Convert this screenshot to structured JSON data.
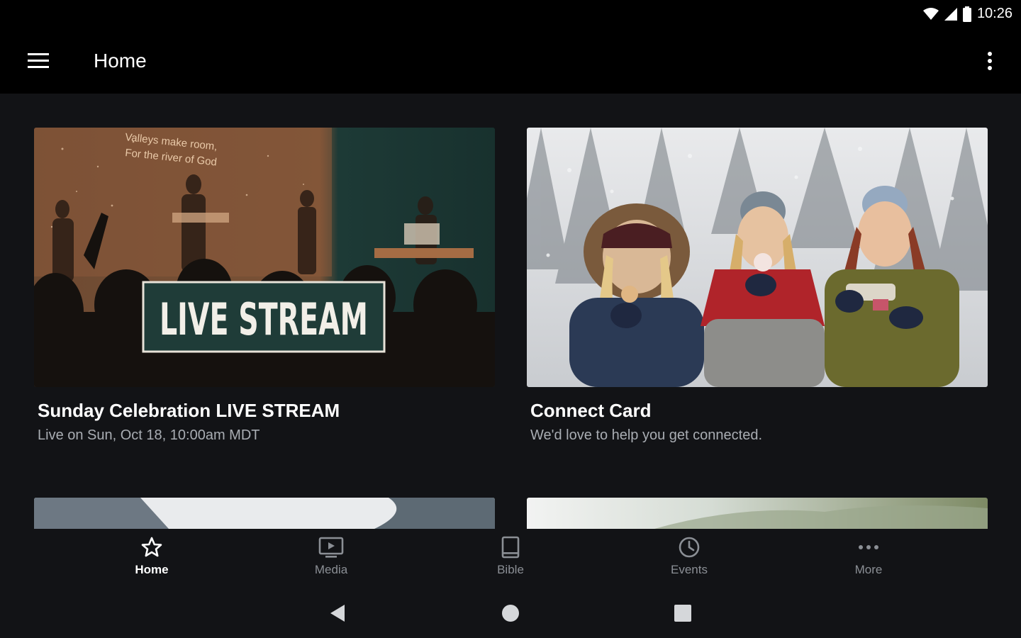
{
  "status": {
    "time": "10:26"
  },
  "appbar": {
    "title": "Home"
  },
  "cards": [
    {
      "title": "Sunday Celebration LIVE STREAM",
      "subtitle": "Live on Sun, Oct 18, 10:00am MDT",
      "overlay_text": "LIVE STREAM",
      "slide_text_1": "Valleys make room,",
      "slide_text_2": "For the river of God"
    },
    {
      "title": "Connect Card",
      "subtitle": "We'd love to help you get connected."
    }
  ],
  "bottom_nav": [
    {
      "label": "Home",
      "icon": "star-icon",
      "active": true
    },
    {
      "label": "Media",
      "icon": "tv-icon",
      "active": false
    },
    {
      "label": "Bible",
      "icon": "book-icon",
      "active": false
    },
    {
      "label": "Events",
      "icon": "clock-icon",
      "active": false
    },
    {
      "label": "More",
      "icon": "more-horiz-icon",
      "active": false
    }
  ],
  "colors": {
    "background": "#121316",
    "bar": "#000000",
    "active": "#ffffff",
    "inactive": "#8b8f95",
    "subtitle": "#a9adb3",
    "livestream_tint": "#1e3a35",
    "livestream_accent": "#b06a3a"
  }
}
